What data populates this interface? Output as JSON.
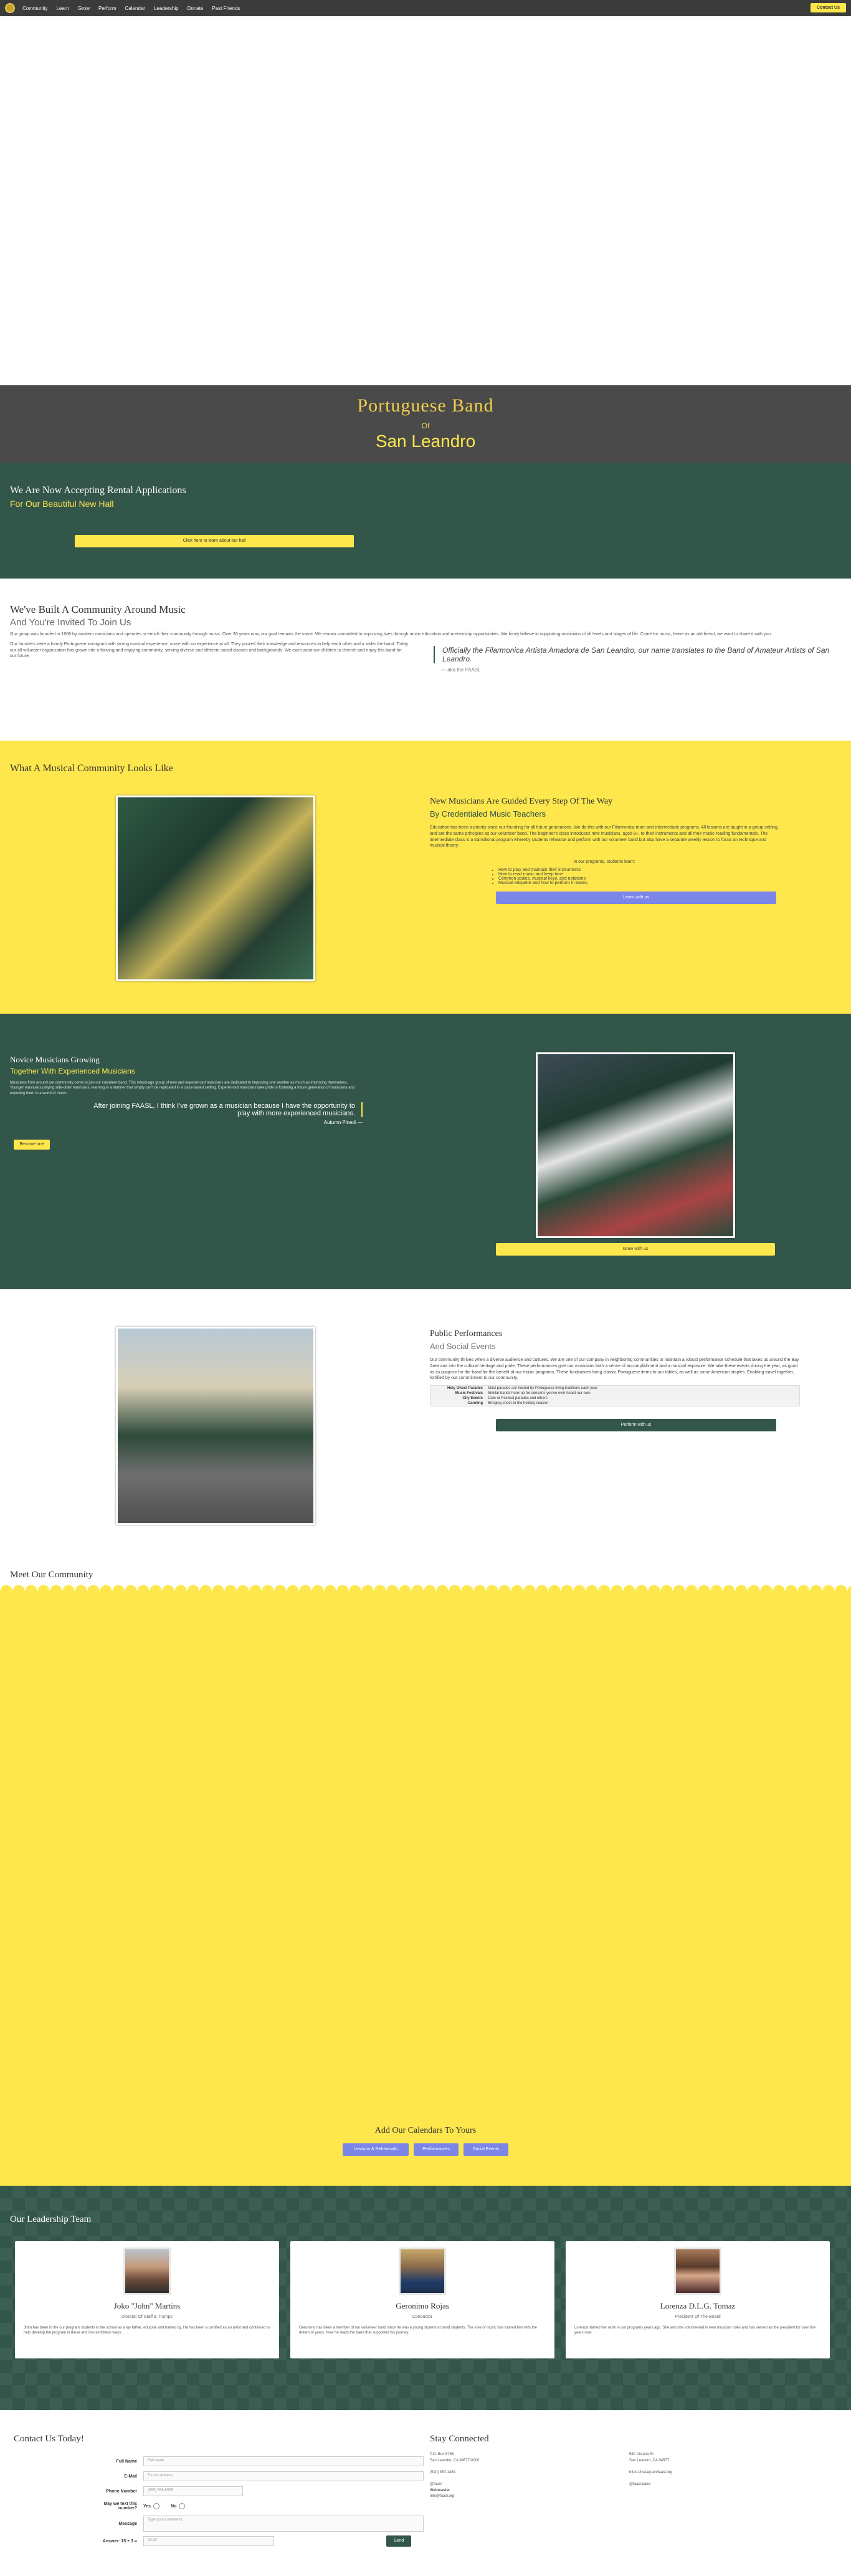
{
  "nav": {
    "items": [
      "Community",
      "Learn",
      "Grow",
      "Perform",
      "Calendar",
      "Leadership",
      "Donate",
      "Past Friends"
    ],
    "cta": "Contact Us"
  },
  "hero": {
    "title": "Portuguese Band",
    "of": "Of",
    "subtitle": "San Leandro"
  },
  "rental": {
    "heading": "We Are Now Accepting Rental Applications",
    "subheading": "For Our Beautiful New Hall",
    "button": "Click here to learn about our hall"
  },
  "community": {
    "heading": "We've Built A Community Around Music",
    "subheading": "And You're Invited To Join Us",
    "para1": "Our group was founded in 1906 by amateur musicians and operates to enrich their community through music. Over 30 years now, our goal remains the same. We remain committed to improving lives through music education and mentorship opportunities. We firmly believe in supporting musicians of all levels and stages of life. Come for music, leave as an old friend, we want to share it with you.",
    "para2": "Our founders were a handy Portuguese immigrant with strong musical experience, some with no experience at all. They poured their knowledge and resources to help each other and a wider the band. Today our all volunteer organization has grown into a thriving and enjoying community, serving diverse and different social classes and backgrounds. We each want our children to cherish and enjoy this band for our future.",
    "quote": "Officially the Filarmonica Artista Amadora de San Leandro, our name translates to the Band of Amateur Artists of San Leandro.",
    "quote_cite": "— aka the FAASL"
  },
  "musical": {
    "heading": "What A Musical Community Looks Like",
    "title": "New Musicians Are Guided Every Step Of The Way",
    "subtitle": "By Credentialed Music Teachers",
    "para": "Education has been a priority since our founding for all future generations. We do this with our Filarmonica team and intermediate programs. All lessons are taught in a group setting, and are the same principles as our volunteer band. The beginner's class introduces new musicians, aged 8+, to their instruments and all their music-reading fundamentals. The intermediate class is a transitional program whereby students rehearse and perform with our volunteer band but also have a separate weekly lesson to focus on technique and musical theory.",
    "list_intro": "In our programs, students learn:",
    "list": [
      "How to play and maintain their instruments",
      "How to read music and keep time",
      "Common scales, musical keys, and notations",
      "Musical etiquette and how to perform in teams"
    ],
    "button": "Learn with us"
  },
  "novice": {
    "heading": "Novice Musicians Growing",
    "subheading": "Together With Experienced Musicians",
    "para": "Musicians from around our community come to join our volunteer band. This mixed-age group of new and experienced musicians are dedicated to improving one another as much as improving themselves. Younger musicians playing side-older musicians, learning in a manner that simply can't be replicated in a class-based setting. Experienced musicians take pride in fostering a future generation of musicians and exposing them to a world of music.",
    "quote": "After joining FAASL, I think I've grown as a musician because I have the opportunity to play with more experienced musicians.",
    "cite": "Autumn Pinedi —",
    "left_button": "Become one",
    "button": "Grow with us"
  },
  "public": {
    "title": "Public Performances",
    "subtitle": "And Social Events",
    "para": "Our community thrives when a diverse audience and cultures. We are one of our company in neighboring communities to maintain a robust performance schedule that takes us around the Bay Area and into the cultural heritage and pride. These performances give our musicians both a sense of accomplishment and a musical exposure. We take these events during the year, as good as its purpose for the band for the benefit of our music programs. These fundraisers bring classic Portuguese items to our tables, as well as some American staples. Enabling travel together, fortified by our commitment to our community.",
    "rows": [
      {
        "k": "Holy Ghost Parades",
        "v": "Most parades are hosted by Portuguese living traditions each year"
      },
      {
        "k": "Music Festivals",
        "v": "Similar bands hook up for concerts you've ever heard our own"
      },
      {
        "k": "City Events",
        "v": "Civic or Festival parades and others"
      },
      {
        "k": "Caroling",
        "v": "Bringing cheer to the holiday season"
      }
    ],
    "button": "Perform with us"
  },
  "meet": {
    "heading": "Meet Our Community",
    "calendar_heading": "Add Our Calendars To Yours",
    "calendar_buttons": [
      "Lessons & Rehearsals",
      "Performances",
      "Social Events"
    ]
  },
  "leadership": {
    "heading": "Our Leadership Team",
    "people": [
      {
        "name": "Joko \"John\" Martins",
        "role": "Director Of Staff & Trumps",
        "bio": "John has been in the our program students in the school as a lay father, educate and trained by. He has been a certified as an artist and continued to help develop the program in these and into exhibition ways."
      },
      {
        "name": "Geronimo Rojas",
        "role": "Conductor",
        "bio": "Geronimo has been a member of our volunteer band since he was a young student at band students. The love of music has trained him with the dream of years. Now he leads the band that supported his journey."
      },
      {
        "name": "Lorenza D.L.G. Tomaz",
        "role": "President Of The Board",
        "bio": "Lorenza started her work in our programs years ago. She and she volunteered in new musician roles and has served as the president for over five years now."
      }
    ]
  },
  "contact": {
    "heading": "Contact Us Today!",
    "fields": [
      {
        "label": "Full Name",
        "placeholder": "Full name"
      },
      {
        "label": "E-Mail",
        "placeholder": "E-mail address"
      },
      {
        "label": "Phone Number",
        "placeholder": "(555) 555-5555"
      }
    ],
    "radio_label": "May we text this number?",
    "radio_yes": "Yes",
    "radio_no": "No",
    "message_label": "Message",
    "message_placeholder": "Type your comments",
    "captcha_label": "Answer: 15 + 3 =",
    "captcha_placeholder": "00.00",
    "send": "Send"
  },
  "stay": {
    "heading": "Stay Connected",
    "left": [
      "P.O. Box 5766",
      "San Leandro, CA 94577-0000",
      "",
      "(510) 357-1489",
      "",
      "@faasl",
      "Webmaster",
      "Info@faasl.org"
    ],
    "right": [
      "580 Victoria St",
      "San Leandro, CA 94577",
      "",
      "https://instagram/faasl.org",
      "",
      "@faasl.band"
    ]
  }
}
